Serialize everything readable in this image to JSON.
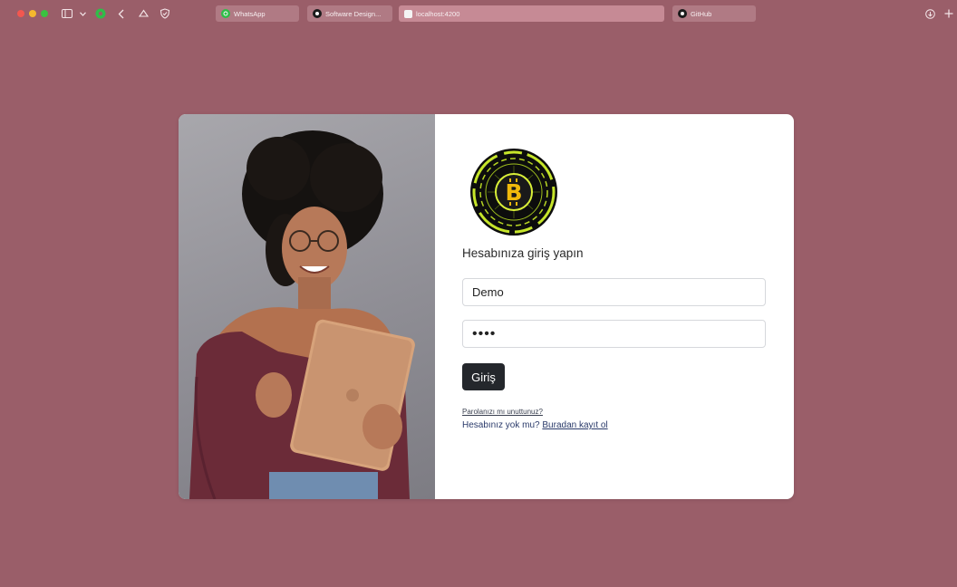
{
  "browser": {
    "tabs": [
      {
        "label": "WhatsApp",
        "icon": "whatsapp-icon"
      },
      {
        "label": "Software Design...",
        "icon": "github-icon"
      },
      {
        "label": "localhost:4200",
        "icon": "localhost-favicon"
      },
      {
        "label": "GitHub",
        "icon": "github-icon"
      }
    ],
    "active_tab": 2
  },
  "login": {
    "heading": "Hesabınıza giriş yapın",
    "username_value": "Demo",
    "password_value": "••••",
    "submit_label": "Giriş",
    "forgot_label": "Parolanızı mı unuttunuz?",
    "no_account_text": "Hesabınız yok mu?",
    "register_link": "Buradan kayıt ol"
  },
  "colors": {
    "page_bg": "#9a5e69",
    "button_bg": "#24272c",
    "logo_gold": "#f0b90b",
    "logo_green": "#c6e52a"
  }
}
